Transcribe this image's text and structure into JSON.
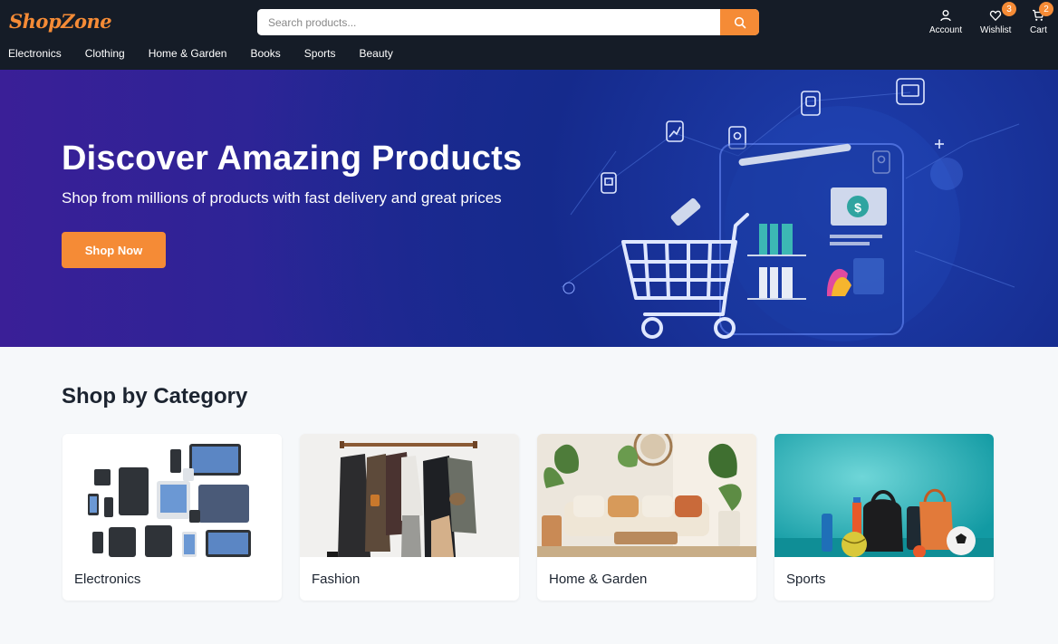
{
  "header": {
    "logo": "ShopZone",
    "search": {
      "placeholder": "Search products...",
      "value": ""
    },
    "actions": [
      {
        "label": "Account",
        "icon": "user-icon"
      },
      {
        "label": "Wishlist",
        "icon": "heart-icon",
        "badge": "3"
      },
      {
        "label": "Cart",
        "icon": "cart-icon",
        "badge": "2"
      }
    ],
    "nav": [
      "Electronics",
      "Clothing",
      "Home & Garden",
      "Books",
      "Sports",
      "Beauty"
    ]
  },
  "hero": {
    "title": "Discover Amazing Products",
    "subtitle": "Shop from millions of products with fast delivery and great prices",
    "cta": "Shop Now",
    "art_icon": "shopping-cart-illustration"
  },
  "categories": {
    "title": "Shop by Category",
    "items": [
      {
        "label": "Electronics",
        "image": "electronics-devices-image"
      },
      {
        "label": "Fashion",
        "image": "clothing-rack-image"
      },
      {
        "label": "Home & Garden",
        "image": "living-room-plants-image"
      },
      {
        "label": "Sports",
        "image": "sports-gear-image"
      }
    ]
  },
  "colors": {
    "accent": "#f58b36",
    "header_bg": "#151c27",
    "hero_bg": "#2a2596"
  }
}
